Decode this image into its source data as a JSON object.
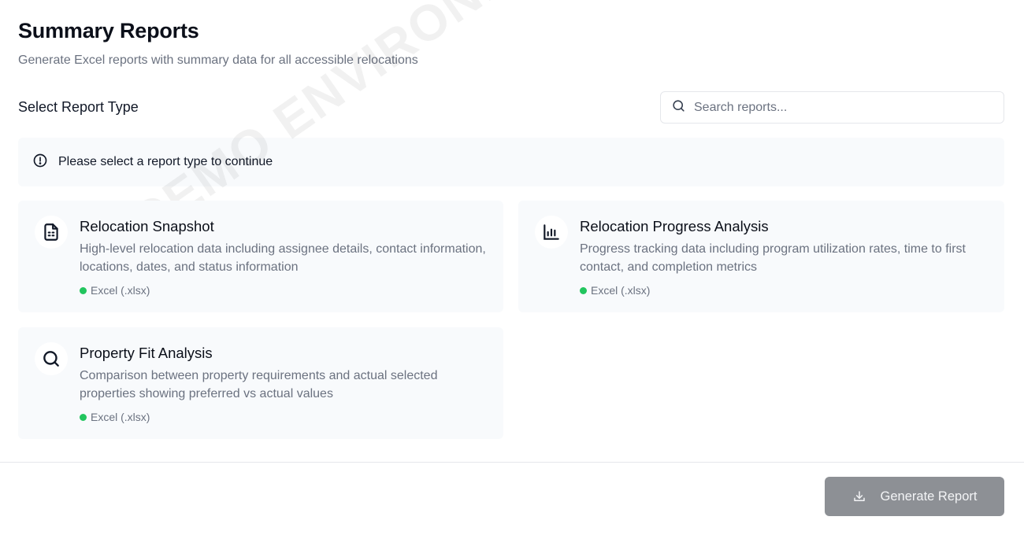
{
  "header": {
    "title": "Summary Reports",
    "subtitle": "Generate Excel reports with summary data for all accessible relocations"
  },
  "section_label": "Select Report Type",
  "search": {
    "placeholder": "Search reports...",
    "value": "",
    "icon": "search-icon"
  },
  "alert": {
    "icon": "alert-circle-icon",
    "message": "Please select a report type to continue"
  },
  "reports": [
    {
      "icon": "spreadsheet-file-icon",
      "title": "Relocation Snapshot",
      "description": "High-level relocation data including assignee details, contact information, locations, dates, and status information",
      "format": "Excel (.xlsx)"
    },
    {
      "icon": "bar-chart-icon",
      "title": "Relocation Progress Analysis",
      "description": "Progress tracking data including program utilization rates, time to first contact, and completion metrics",
      "format": "Excel (.xlsx)"
    },
    {
      "icon": "search-icon",
      "title": "Property Fit Analysis",
      "description": "Comparison between property requirements and actual selected properties showing preferred vs actual values",
      "format": "Excel (.xlsx)"
    }
  ],
  "watermark": "DEMO ENVIRONMENT",
  "footer": {
    "generate_label": "Generate Report",
    "generate_icon": "download-icon"
  },
  "colors": {
    "format_dot": "#22c55e",
    "button_disabled": "#8d9095",
    "card_bg": "#f8fafc"
  }
}
